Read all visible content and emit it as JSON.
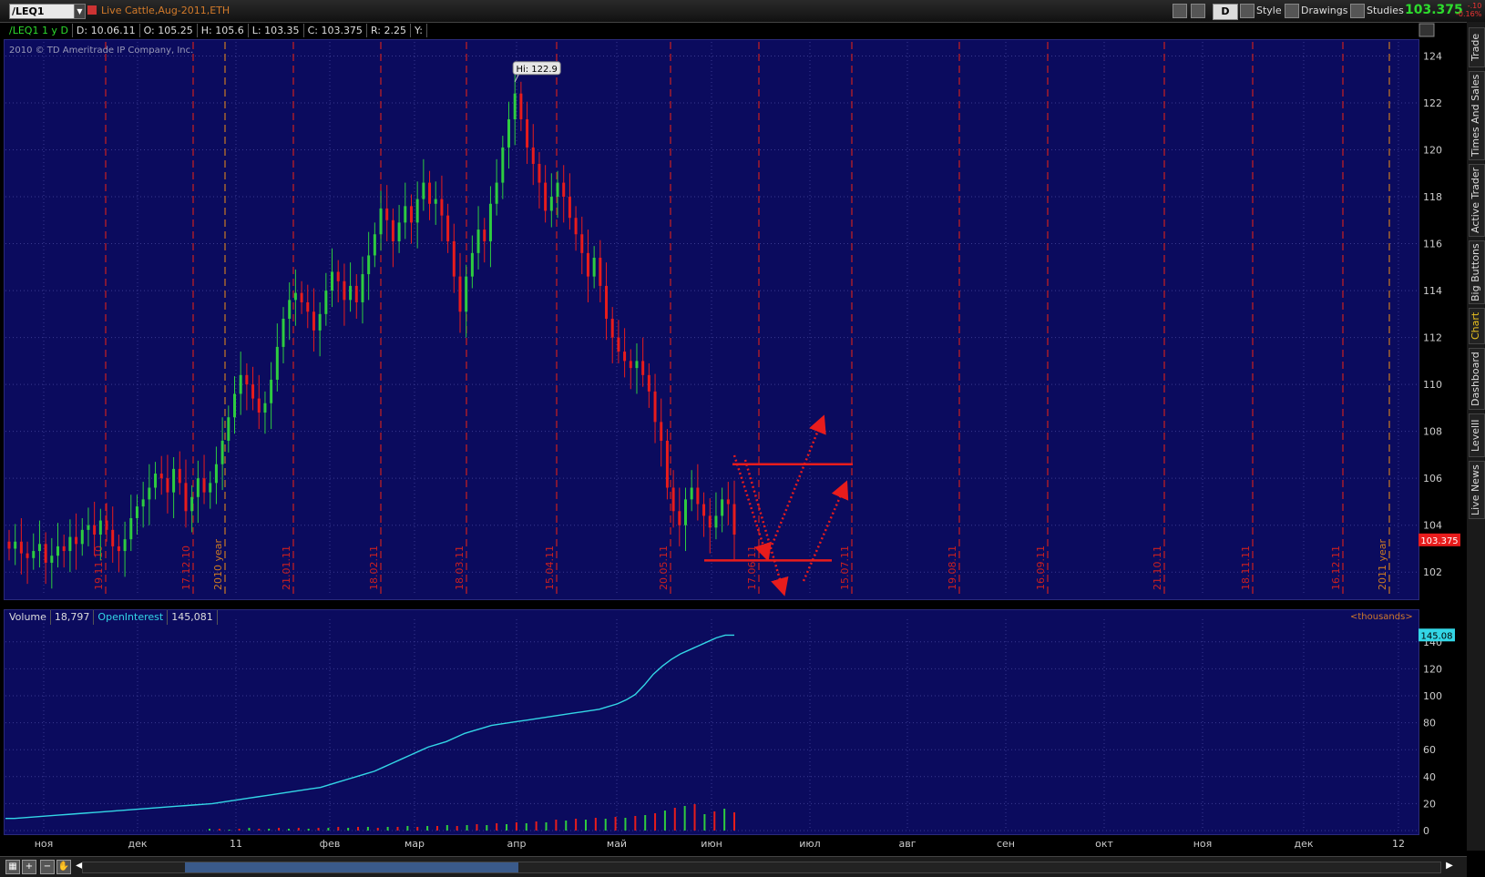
{
  "topbar": {
    "symbol": "/LEQ1",
    "instrument": "Live Cattle,Aug-2011,ETH",
    "period_btn": "D",
    "style_label": "Style",
    "drawings_label": "Drawings",
    "studies_label": "Studies",
    "last_price": "103.375",
    "change_line1": "-.10",
    "change_line2": "-0.16%"
  },
  "infobar": {
    "symbol_period": "/LEQ1 1 y D",
    "date": "D: 10.06.11",
    "open": "O: 105.25",
    "high": "H: 105.6",
    "low": "L: 103.35",
    "close": "C: 103.375",
    "range": "R: 2.25",
    "y": "Y:"
  },
  "copyright": "2010 © TD Ameritrade IP Company, Inc.",
  "hi_label": "Hi: 122.9",
  "volume_header": {
    "volume_label": "Volume",
    "volume_value": "18,797",
    "oi_label": "OpenInterest",
    "oi_value": "145,081",
    "units": "<thousands>"
  },
  "side_tabs": [
    "Trade",
    "Times And Sales",
    "Active Trader",
    "Big Buttons",
    "Chart",
    "Dashboard",
    "LevelII",
    "Live News"
  ],
  "colors": {
    "panel_bg": "#0b0b5e",
    "up": "#2ecc40",
    "down": "#e81c1c",
    "oi_line": "#33d6e6",
    "annotation": "#e81c1c",
    "price_tag": "#e81c1c"
  },
  "chart_data": {
    "type": "line",
    "title": "",
    "xlabel": "",
    "ylabel": "",
    "price_axis": {
      "ticks": [
        102,
        104,
        106,
        108,
        110,
        112,
        114,
        116,
        118,
        120,
        122,
        124
      ],
      "ylim": [
        101,
        124.6
      ]
    },
    "price_tag": "103.375",
    "oi_axis": {
      "ticks": [
        0,
        20,
        40,
        60,
        80,
        100,
        120,
        140
      ],
      "ylim": [
        0,
        150
      ]
    },
    "oi_tag": "145.08",
    "month_labels": [
      "ноя",
      "дек",
      "11",
      "фев",
      "мар",
      "апр",
      "май",
      "июн",
      "июл",
      "авг",
      "сен",
      "окт",
      "ноя",
      "дек",
      "12"
    ],
    "vertical_marker_labels": [
      "19.11.10",
      "17.12.10",
      "2010 year",
      "21.01.11",
      "18.02.11",
      "18.03.11",
      "15.04.11",
      "20.05.11",
      "17.06.11",
      "15.07.11",
      "19.08.11",
      "16.09.11",
      "21.10.11",
      "18.11.11",
      "16.12.11",
      "2011 year"
    ],
    "high_value": 122.9,
    "price_series": {
      "name": "",
      "values": [
        103.0,
        103.3,
        102.8,
        102.6,
        102.9,
        103.2,
        102.4,
        102.7,
        103.1,
        102.9,
        103.5,
        103.2,
        103.8,
        104.0,
        103.6,
        104.2,
        103.8,
        103.1,
        102.9,
        103.4,
        104.3,
        104.8,
        105.1,
        105.6,
        106.2,
        106.0,
        105.4,
        106.4,
        105.8,
        104.6,
        105.2,
        106.0,
        105.4,
        105.8,
        106.6,
        107.6,
        108.6,
        109.6,
        110.4,
        110.0,
        109.4,
        108.8,
        109.2,
        110.2,
        111.6,
        112.8,
        113.6,
        113.9,
        113.5,
        113.1,
        112.3,
        113.0,
        114.0,
        114.8,
        114.4,
        113.6,
        114.2,
        113.5,
        114.7,
        115.5,
        116.4,
        117.5,
        117.0,
        116.1,
        116.9,
        117.6,
        116.9,
        117.9,
        118.6,
        117.7,
        117.9,
        117.2,
        116.1,
        114.6,
        113.1,
        114.6,
        115.6,
        116.6,
        116.1,
        117.7,
        118.6,
        120.1,
        121.3,
        122.4,
        121.3,
        120.1,
        119.4,
        118.6,
        117.4,
        118.0,
        118.6,
        118.0,
        117.1,
        116.4,
        115.6,
        114.6,
        115.4,
        114.2,
        112.8,
        112.0,
        111.4,
        111.0,
        110.7,
        111.0,
        110.4,
        109.7,
        108.4,
        107.6,
        105.6,
        104.6,
        104.0,
        105.1,
        105.6,
        104.9,
        104.4,
        103.9,
        104.4,
        105.1,
        104.9,
        103.6
      ]
    },
    "ohlc_series": {
      "name": "",
      "high": 105.6,
      "low": 103.35,
      "open": 105.25,
      "close": 103.375
    },
    "oi_series": {
      "name": "OpenInterest",
      "values": [
        9,
        9,
        9.5,
        10,
        10.5,
        11,
        11.5,
        12,
        12.5,
        13,
        13.5,
        14,
        14.5,
        15,
        15.5,
        16,
        16.5,
        17,
        17.5,
        18,
        18.5,
        19,
        19.5,
        20,
        21,
        22,
        23,
        24,
        25,
        26,
        27,
        28,
        29,
        30,
        31,
        32,
        34,
        36,
        38,
        40,
        42,
        44,
        47,
        50,
        53,
        56,
        59,
        62,
        64,
        66,
        69,
        72,
        74,
        76,
        78,
        79,
        80,
        81,
        82,
        83,
        84,
        85,
        86,
        87,
        88,
        89,
        90,
        92,
        94,
        97,
        101,
        108,
        116,
        122,
        127,
        131,
        134,
        137,
        140,
        143,
        145,
        145
      ]
    },
    "volume_series": {
      "name": "Volume",
      "values": [
        2,
        2,
        1,
        2,
        3,
        2,
        2,
        3,
        2,
        3,
        2,
        3,
        3,
        4,
        3,
        4,
        4,
        3,
        4,
        4,
        5,
        4,
        5,
        5,
        6,
        5,
        6,
        7,
        6,
        8,
        7,
        9,
        8,
        10,
        9,
        12,
        11,
        13,
        12,
        14,
        13,
        15,
        14,
        16,
        17,
        19,
        22,
        25,
        27,
        29,
        18,
        21,
        24,
        20
      ]
    },
    "annotations": {
      "resistance_level": 106.6,
      "support_level": 102.5
    }
  }
}
